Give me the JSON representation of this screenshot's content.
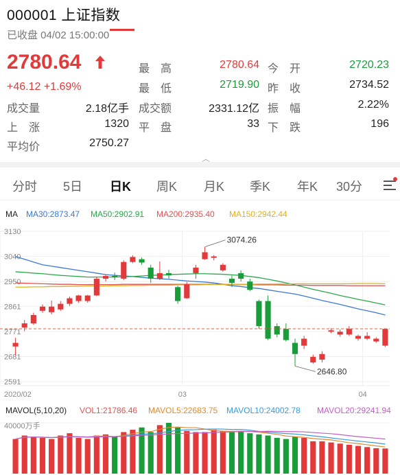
{
  "header": {
    "title": "000001  上证指数",
    "status": "已收盘 04/02 15:00:00"
  },
  "quote": {
    "price": "2780.64",
    "change": "+46.12  +1.69%",
    "stats": [
      {
        "label": "最　高",
        "value": "2780.64",
        "color": "red"
      },
      {
        "label": "今　开",
        "value": "2720.23",
        "color": "green"
      },
      {
        "label": "最　低",
        "value": "2719.90",
        "color": "green"
      },
      {
        "label": "昨　收",
        "value": "2734.52",
        "color": "black"
      },
      {
        "label": "成交量",
        "value": "2.18亿手",
        "color": "black"
      },
      {
        "label": "成交额",
        "value": "2331.12亿",
        "color": "black"
      },
      {
        "label": "振　幅",
        "value": "2.22%",
        "color": "black"
      },
      {
        "label": "上　涨",
        "value": "1320",
        "color": "black"
      },
      {
        "label": "平　盘",
        "value": "33",
        "color": "black"
      },
      {
        "label": "下　跌",
        "value": "196",
        "color": "black"
      },
      {
        "label": "平均价",
        "value": "2750.27",
        "color": "black"
      }
    ],
    "expand_icon": "chevron-up-icon"
  },
  "tabs": [
    {
      "label": "分时"
    },
    {
      "label": "5日"
    },
    {
      "label": "日K",
      "active": true
    },
    {
      "label": "周K"
    },
    {
      "label": "月K"
    },
    {
      "label": "季K"
    },
    {
      "label": "年K"
    },
    {
      "label": "30分"
    }
  ],
  "settings_icon": "settings-menu-icon",
  "ma_legend": [
    {
      "text": "MA",
      "color": "#222222"
    },
    {
      "text": "MA30:2873.47",
      "color": "#3a78d8"
    },
    {
      "text": "MA50:2902.91",
      "color": "#2aa84a"
    },
    {
      "text": "MA200:2935.40",
      "color": "#e25050"
    },
    {
      "text": "MA150:2942.44",
      "color": "#e0b020"
    }
  ],
  "vol_legend": [
    {
      "text": "MAVOL(5,10,20)",
      "color": "#222222"
    },
    {
      "text": "VOL1:21786.46",
      "color": "#e25050"
    },
    {
      "text": "MAVOL5:22683.75",
      "color": "#e08a30"
    },
    {
      "text": "MAVOL10:24002.78",
      "color": "#3a9ad8"
    },
    {
      "text": "MAVOL20:29241.94",
      "color": "#c060c0"
    }
  ],
  "colors": {
    "up": "#e23a3a",
    "down": "#1a9c3a"
  },
  "chart_data": {
    "type": "candlestick",
    "y_ticks": [
      "3130",
      "3040",
      "2950",
      "2861",
      "2771",
      "2681",
      "2591"
    ],
    "y_tick_values": [
      3130,
      3040,
      2950,
      2861,
      2771,
      2681,
      2591
    ],
    "ylim": [
      2591,
      3130
    ],
    "x_ticks": [
      {
        "label": "2020/02",
        "index": 0
      },
      {
        "label": "03",
        "index": 19
      },
      {
        "label": "04",
        "index": 39
      }
    ],
    "current_price_line": 2780.64,
    "annotations": [
      {
        "text": "3074.26",
        "index": 21,
        "value": 3074.26
      },
      {
        "text": "2646.80",
        "index": 31,
        "value": 2646.8
      }
    ],
    "candles": [
      {
        "o": 2717,
        "c": 2730,
        "h": 2748,
        "l": 2685
      },
      {
        "o": 2785,
        "c": 2800,
        "h": 2812,
        "l": 2772
      },
      {
        "o": 2800,
        "c": 2830,
        "h": 2838,
        "l": 2795
      },
      {
        "o": 2845,
        "c": 2860,
        "h": 2868,
        "l": 2838
      },
      {
        "o": 2840,
        "c": 2860,
        "h": 2882,
        "l": 2832
      },
      {
        "o": 2850,
        "c": 2870,
        "h": 2880,
        "l": 2845
      },
      {
        "o": 2870,
        "c": 2890,
        "h": 2896,
        "l": 2862
      },
      {
        "o": 2880,
        "c": 2900,
        "h": 2902,
        "l": 2874
      },
      {
        "o": 2880,
        "c": 2900,
        "h": 2902,
        "l": 2874
      },
      {
        "o": 2900,
        "c": 2960,
        "h": 2966,
        "l": 2898
      },
      {
        "o": 2960,
        "c": 2970,
        "h": 2976,
        "l": 2950
      },
      {
        "o": 2970,
        "c": 2965,
        "h": 2982,
        "l": 2955
      },
      {
        "o": 2960,
        "c": 3020,
        "h": 3026,
        "l": 2955
      },
      {
        "o": 3020,
        "c": 3038,
        "h": 3044,
        "l": 3016
      },
      {
        "o": 3030,
        "c": 3018,
        "h": 3036,
        "l": 3010
      },
      {
        "o": 3000,
        "c": 2960,
        "h": 3010,
        "l": 2945
      },
      {
        "o": 2960,
        "c": 2980,
        "h": 3022,
        "l": 2955
      },
      {
        "o": 2980,
        "c": 2972,
        "h": 2992,
        "l": 2960
      },
      {
        "o": 2930,
        "c": 2880,
        "h": 2935,
        "l": 2870
      },
      {
        "o": 2890,
        "c": 2940,
        "h": 2948,
        "l": 2888
      },
      {
        "o": 2980,
        "c": 3000,
        "h": 3010,
        "l": 2960
      },
      {
        "o": 3030,
        "c": 3055,
        "h": 3074,
        "l": 3028
      },
      {
        "o": 3035,
        "c": 3040,
        "h": 3045,
        "l": 3026
      },
      {
        "o": 2990,
        "c": 3010,
        "h": 3016,
        "l": 2985
      },
      {
        "o": 2960,
        "c": 2945,
        "h": 2972,
        "l": 2930
      },
      {
        "o": 2980,
        "c": 2960,
        "h": 2990,
        "l": 2950
      },
      {
        "o": 2950,
        "c": 2920,
        "h": 2960,
        "l": 2915
      },
      {
        "o": 2880,
        "c": 2790,
        "h": 2885,
        "l": 2780
      },
      {
        "o": 2880,
        "c": 2745,
        "h": 2900,
        "l": 2740
      },
      {
        "o": 2790,
        "c": 2760,
        "h": 2800,
        "l": 2750
      },
      {
        "o": 2780,
        "c": 2740,
        "h": 2800,
        "l": 2735
      },
      {
        "o": 2730,
        "c": 2690,
        "h": 2745,
        "l": 2647
      },
      {
        "o": 2720,
        "c": 2745,
        "h": 2755,
        "l": 2708
      },
      {
        "o": 2660,
        "c": 2680,
        "h": 2688,
        "l": 2655
      },
      {
        "o": 2670,
        "c": 2690,
        "h": 2700,
        "l": 2660
      },
      {
        "o": 2770,
        "c": 2775,
        "h": 2782,
        "l": 2765
      },
      {
        "o": 2760,
        "c": 2770,
        "h": 2778,
        "l": 2752
      },
      {
        "o": 2760,
        "c": 2780,
        "h": 2790,
        "l": 2755
      },
      {
        "o": 2745,
        "c": 2755,
        "h": 2760,
        "l": 2738
      },
      {
        "o": 2745,
        "c": 2755,
        "h": 2768,
        "l": 2740
      },
      {
        "o": 2735,
        "c": 2745,
        "h": 2750,
        "l": 2730
      },
      {
        "o": 2720,
        "c": 2780,
        "h": 2781,
        "l": 2715
      }
    ],
    "ma_series": [
      {
        "name": "MA30",
        "color": "#3a78d8",
        "values": [
          3040,
          3030,
          3020,
          3010,
          3005,
          3000,
          2995,
          2990,
          2985,
          2980,
          2975,
          2972,
          2970,
          2968,
          2965,
          2962,
          2960,
          2958,
          2955,
          2952,
          2950,
          2948,
          2945,
          2940,
          2935,
          2932,
          2928,
          2925,
          2920,
          2915,
          2910,
          2905,
          2898,
          2890,
          2882,
          2875,
          2868,
          2860,
          2852,
          2845,
          2838,
          2830
        ]
      },
      {
        "name": "MA50",
        "color": "#2aa84a",
        "values": [
          2985,
          2983,
          2980,
          2978,
          2975,
          2972,
          2970,
          2968,
          2966,
          2966,
          2966,
          2966,
          2967,
          2968,
          2970,
          2972,
          2973,
          2975,
          2976,
          2977,
          2978,
          2978,
          2977,
          2976,
          2974,
          2972,
          2968,
          2964,
          2958,
          2952,
          2945,
          2938,
          2930,
          2922,
          2915,
          2908,
          2900,
          2893,
          2886,
          2880,
          2873,
          2866
        ]
      },
      {
        "name": "MA200",
        "color": "#e25050",
        "values": [
          2945,
          2944,
          2943,
          2942,
          2941,
          2940,
          2940,
          2939,
          2939,
          2939,
          2939,
          2939,
          2940,
          2940,
          2940,
          2940,
          2940,
          2940,
          2940,
          2940,
          2940,
          2940,
          2940,
          2940,
          2939,
          2939,
          2939,
          2938,
          2938,
          2938,
          2937,
          2937,
          2937,
          2936,
          2936,
          2936,
          2936,
          2935,
          2935,
          2935,
          2935,
          2935
        ]
      },
      {
        "name": "MA150",
        "color": "#e0b020",
        "values": [
          2930,
          2930,
          2931,
          2931,
          2932,
          2932,
          2933,
          2933,
          2934,
          2934,
          2934,
          2935,
          2935,
          2936,
          2936,
          2937,
          2937,
          2937,
          2938,
          2938,
          2938,
          2939,
          2939,
          2939,
          2940,
          2940,
          2940,
          2941,
          2941,
          2941,
          2941,
          2942,
          2942,
          2942,
          2942,
          2942,
          2942,
          2942,
          2943,
          2943,
          2943,
          2942
        ]
      }
    ],
    "volume": {
      "axis_label": "40000万手",
      "max": 44000,
      "values": [
        30000,
        33000,
        32000,
        31000,
        30000,
        33000,
        35000,
        31000,
        30000,
        33000,
        34000,
        32000,
        36000,
        38000,
        40000,
        36000,
        42000,
        44000,
        40000,
        37000,
        36000,
        36000,
        38000,
        37000,
        36000,
        37000,
        35000,
        34000,
        33000,
        31000,
        30000,
        32000,
        31000,
        28000,
        28000,
        27000,
        26000,
        25000,
        24000,
        23000,
        22000,
        21786
      ]
    }
  }
}
